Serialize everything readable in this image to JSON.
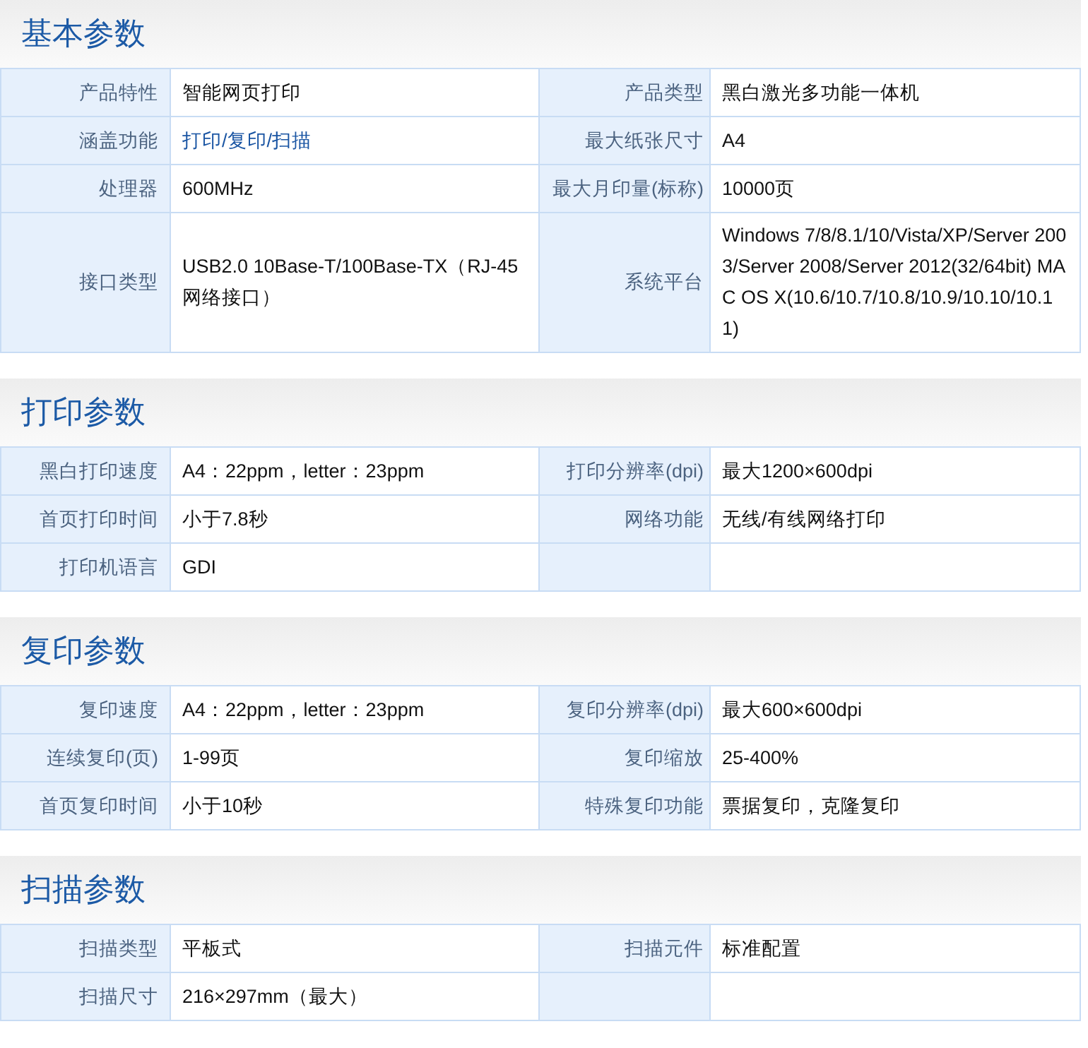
{
  "sections": [
    {
      "title": "基本参数",
      "rows": [
        [
          {
            "label": "产品特性",
            "value": "智能网页打印"
          },
          {
            "label": "产品类型",
            "value": "黑白激光多功能一体机"
          }
        ],
        [
          {
            "label": "涵盖功能",
            "value": "打印/复印/扫描",
            "link": true
          },
          {
            "label": "最大纸张尺寸",
            "value": "A4"
          }
        ],
        [
          {
            "label": "处理器",
            "value": "600MHz"
          },
          {
            "label": "最大月印量(标称)",
            "value": "10000页"
          }
        ],
        [
          {
            "label": "接口类型",
            "value": "USB2.0 10Base-T/100Base-TX（RJ-45网络接口）"
          },
          {
            "label": "系统平台",
            "value": "Windows 7/8/8.1/10/Vista/XP/Server 2003/Server 2008/Server 2012(32/64bit) MAC OS X(10.6/10.7/10.8/10.9/10.10/10.11)"
          }
        ]
      ]
    },
    {
      "title": "打印参数",
      "rows": [
        [
          {
            "label": "黑白打印速度",
            "value": "A4：22ppm，letter：23ppm"
          },
          {
            "label": "打印分辨率(dpi)",
            "value": "最大1200×600dpi"
          }
        ],
        [
          {
            "label": "首页打印时间",
            "value": "小于7.8秒"
          },
          {
            "label": "网络功能",
            "value": "无线/有线网络打印"
          }
        ],
        [
          {
            "label": "打印机语言",
            "value": "GDI"
          }
        ]
      ]
    },
    {
      "title": "复印参数",
      "rows": [
        [
          {
            "label": "复印速度",
            "value": "A4：22ppm，letter：23ppm"
          },
          {
            "label": "复印分辨率(dpi)",
            "value": "最大600×600dpi"
          }
        ],
        [
          {
            "label": "连续复印(页)",
            "value": "1-99页"
          },
          {
            "label": "复印缩放",
            "value": "25-400%"
          }
        ],
        [
          {
            "label": "首页复印时间",
            "value": "小于10秒"
          },
          {
            "label": "特殊复印功能",
            "value": "票据复印，克隆复印"
          }
        ]
      ]
    },
    {
      "title": "扫描参数",
      "rows": [
        [
          {
            "label": "扫描类型",
            "value": "平板式"
          },
          {
            "label": "扫描元件",
            "value": "标准配置"
          }
        ],
        [
          {
            "label": "扫描尺寸",
            "value": "216×297mm（最大）"
          }
        ]
      ]
    }
  ]
}
